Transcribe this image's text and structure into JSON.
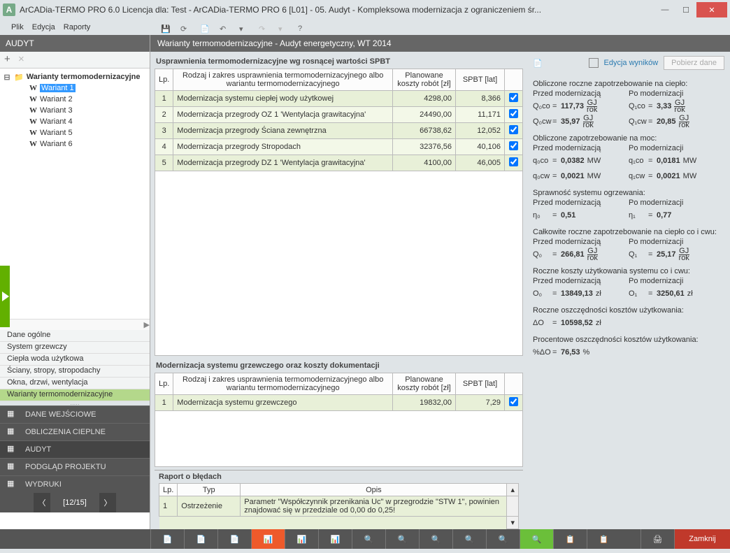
{
  "title": "ArCADia-TERMO PRO 6.0 Licencja dla: Test - ArCADia-TERMO PRO 6 [L01] - 05. Audyt - Kompleksowa modernizacja z ograniczeniem śr...",
  "menu": [
    "Plik",
    "Edycja",
    "Raporty"
  ],
  "leftHeader": "AUDYT",
  "treeRoot": "Warianty termomodernizacyjne",
  "variants": [
    "Wariant 1",
    "Wariant 2",
    "Wariant 3",
    "Wariant 4",
    "Wariant 5",
    "Wariant 6"
  ],
  "categories": [
    {
      "t": "Dane ogólne",
      "a": false,
      "d": false
    },
    {
      "t": "System grzewczy",
      "a": false,
      "d": false
    },
    {
      "t": "Ciepła woda użytkowa",
      "a": false,
      "d": false
    },
    {
      "t": "Ściany, stropy, stropodachy",
      "a": false,
      "d": false
    },
    {
      "t": "Okna, drzwi, wentylacja",
      "a": false,
      "d": false
    },
    {
      "t": "Warianty termomodernizacyjne",
      "a": true,
      "d": false
    }
  ],
  "sections": [
    {
      "t": "DANE WEJŚCIOWE",
      "icon": "input-icon"
    },
    {
      "t": "OBLICZENIA CIEPLNE",
      "icon": "calc-icon"
    },
    {
      "t": "AUDYT",
      "icon": "audit-icon",
      "active": true
    },
    {
      "t": "PODGLĄD PROJEKTU",
      "icon": "preview-icon"
    },
    {
      "t": "WYDRUKI",
      "icon": "print-icon"
    }
  ],
  "pager": "[12/15]",
  "bodyHeader": "Warianty termomodernizacyjne - Audyt energetyczny, WT 2014",
  "tbl1": {
    "caption": "Usprawnienia termomodernizacyjne wg rosnącej wartości SPBT",
    "cols": [
      "Lp.",
      "Rodzaj i zakres usprawnienia termomodernizacyjnego albo wariantu termomodernizacyjnego",
      "Planowane koszty robót [zł]",
      "SPBT [lat]",
      ""
    ],
    "rows": [
      [
        "1",
        "Modernizacja systemu ciepłej wody użytkowej",
        "4298,00",
        "8,366",
        true
      ],
      [
        "2",
        "Modernizacja przegrody OZ 1 'Wentylacja grawitacyjna'",
        "24490,00",
        "11,171",
        true
      ],
      [
        "3",
        "Modernizacja przegrody Ściana zewnętrzna",
        "66738,62",
        "12,052",
        true
      ],
      [
        "4",
        "Modernizacja przegrody Stropodach",
        "32376,56",
        "40,106",
        true
      ],
      [
        "5",
        "Modernizacja przegrody DZ 1 'Wentylacja grawitacyjna'",
        "4100,00",
        "46,005",
        true
      ]
    ]
  },
  "tbl2": {
    "caption": "Modernizacja systemu grzewczego oraz koszty dokumentacji",
    "cols": [
      "Lp.",
      "Rodzaj i zakres usprawnienia termomodernizacyjnego albo wariantu termomodernizacyjnego",
      "Planowane koszty robót [zł]",
      "SPBT [lat]",
      ""
    ],
    "rows": [
      [
        "1",
        "Modernizacja systemu grzewczego",
        "19832,00",
        "7,29",
        true
      ]
    ]
  },
  "right": {
    "editLink": "Edycja wyników",
    "btnFetch": "Pobierz dane",
    "s1": "Obliczone roczne zapotrzebowanie na ciepło:",
    "before": "Przed modernizacją",
    "after": "Po modernizacji",
    "q0co": {
      "s": "Q₀co",
      "v": "117,73",
      "u": "GJ/rok"
    },
    "q1co": {
      "s": "Q₁co",
      "v": "3,33",
      "u": "GJ/rok"
    },
    "q0cw": {
      "s": "Q₀cw",
      "v": "35,97",
      "u": "GJ/rok"
    },
    "q1cw": {
      "s": "Q₁cw",
      "v": "20,85",
      "u": "GJ/rok"
    },
    "s2": "Obliczone zapotrzebowanie na moc:",
    "q0coM": {
      "s": "q₀co",
      "v": "0,0382",
      "u": "MW"
    },
    "q1coM": {
      "s": "q₁co",
      "v": "0,0181",
      "u": "MW"
    },
    "q0cwM": {
      "s": "q₀cw",
      "v": "0,0021",
      "u": "MW"
    },
    "q1cwM": {
      "s": "q₁cw",
      "v": "0,0021",
      "u": "MW"
    },
    "s3": "Sprawność systemu ogrzewania:",
    "n0": {
      "s": "η₀",
      "v": "0,51"
    },
    "n1": {
      "s": "η₁",
      "v": "0,77"
    },
    "s4": "Całkowite roczne zapotrzebowanie na ciepło co i cwu:",
    "q0": {
      "s": "Q₀",
      "v": "266,81",
      "u": "GJ/rok"
    },
    "q1": {
      "s": "Q₁",
      "v": "25,17",
      "u": "GJ/rok"
    },
    "s5": "Roczne koszty użytkowania systemu co i cwu:",
    "o0": {
      "s": "O₀",
      "v": "13849,13",
      "u": "zł"
    },
    "o1": {
      "s": "O₁",
      "v": "3250,61",
      "u": "zł"
    },
    "s6": "Roczne oszczędności kosztów użytkowania:",
    "dO": {
      "s": "ΔO",
      "v": "10598,52",
      "u": "zł"
    },
    "s7": "Procentowe oszczędności kosztów użytkowania:",
    "pdO": {
      "s": "%ΔO",
      "v": "76,53",
      "u": "%"
    }
  },
  "err": {
    "title": "Raport o błędach",
    "cols": [
      "Lp.",
      "Typ",
      "Opis"
    ],
    "row": [
      "1",
      "Ostrzeżenie",
      "Parametr \"Współczynnik przenikania Uc\" w przegrodzie \"STW 1\", powinien znajdować się w przedziale od 0,00 do 0,25!"
    ]
  },
  "closeBtn": "Zamknij"
}
